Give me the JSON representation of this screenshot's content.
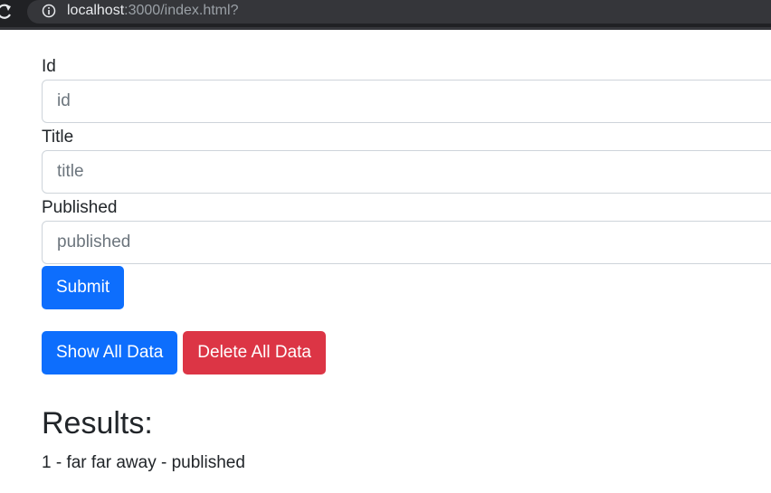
{
  "browser": {
    "url_host": "localhost",
    "url_rest": ":3000/index.html?"
  },
  "form": {
    "id_label": "Id",
    "id_placeholder": "id",
    "title_label": "Title",
    "title_placeholder": "title",
    "published_label": "Published",
    "published_placeholder": "published",
    "submit_label": "Submit"
  },
  "actions": {
    "show_all_label": "Show All Data",
    "delete_all_label": "Delete All Data"
  },
  "results": {
    "heading": "Results:",
    "items": [
      "1 - far far away - published"
    ]
  },
  "colors": {
    "primary": "#0d6efd",
    "danger": "#dc3545",
    "browser_bar": "#202124"
  },
  "icons": {
    "reload": "reload-icon",
    "info": "info-icon"
  }
}
